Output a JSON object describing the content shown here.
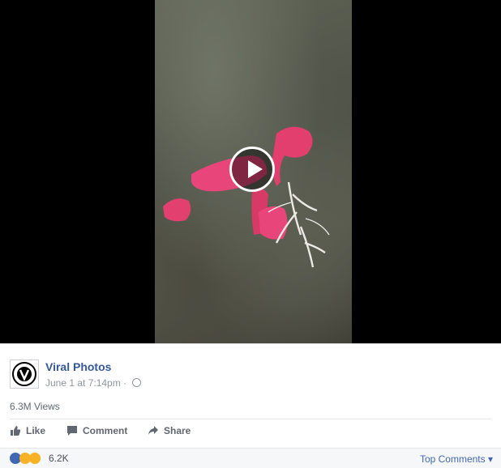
{
  "post": {
    "page_name": "Viral Photos",
    "timestamp": "June 1 at 7:14pm",
    "separator": "·",
    "views": "6.3M Views"
  },
  "actions": {
    "like": "Like",
    "comment": "Comment",
    "share": "Share"
  },
  "reactions": {
    "count": "6.2K",
    "sort_label": "Top Comments ▾"
  },
  "icons": [
    "play-icon",
    "globe-icon",
    "like-icon",
    "comment-icon",
    "share-icon",
    "like-reaction-icon",
    "wow-reaction-icon",
    "haha-reaction-icon"
  ],
  "colors": {
    "link": "#365899",
    "accent": "#4267b2",
    "reaction_pink": "#e8457a"
  }
}
